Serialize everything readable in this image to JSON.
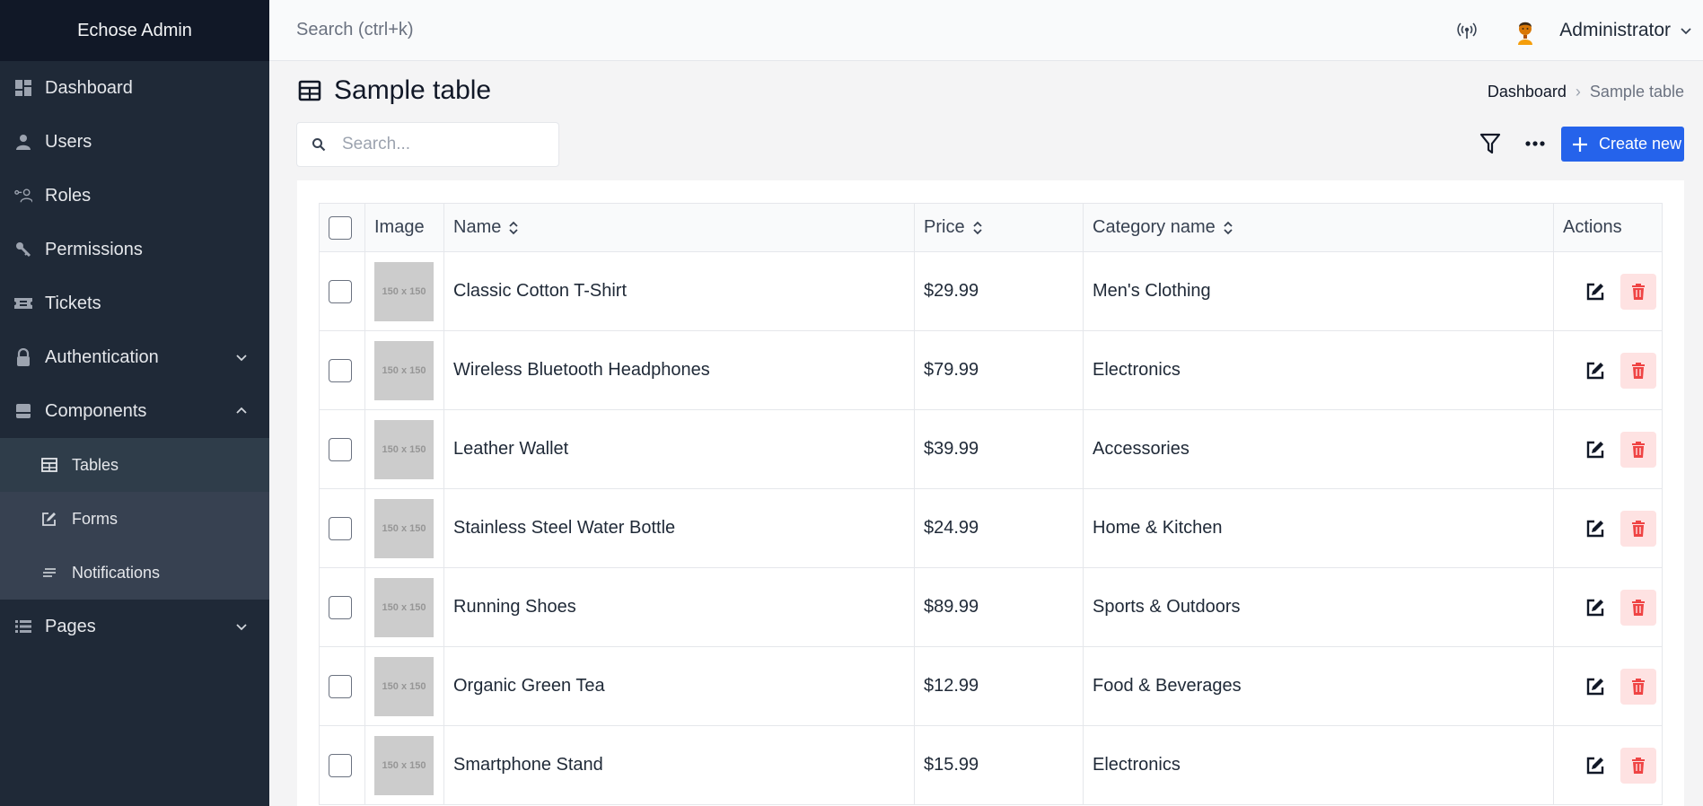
{
  "sidebar": {
    "brand": "Echose Admin",
    "items": [
      {
        "label": "Dashboard",
        "icon": "dashboard-icon"
      },
      {
        "label": "Users",
        "icon": "user-icon"
      },
      {
        "label": "Roles",
        "icon": "roles-icon"
      },
      {
        "label": "Permissions",
        "icon": "key-icon"
      },
      {
        "label": "Tickets",
        "icon": "ticket-icon"
      },
      {
        "label": "Authentication",
        "icon": "lock-icon",
        "expanded": false
      },
      {
        "label": "Components",
        "icon": "archive-icon",
        "expanded": true
      },
      {
        "label": "Pages",
        "icon": "list-icon",
        "expanded": false
      }
    ],
    "components_children": [
      {
        "label": "Tables",
        "icon": "table-icon",
        "active": true
      },
      {
        "label": "Forms",
        "icon": "edit-icon"
      },
      {
        "label": "Notifications",
        "icon": "notes-icon"
      }
    ]
  },
  "topbar": {
    "search_placeholder": "Search (ctrl+k)",
    "username": "Administrator"
  },
  "page": {
    "title": "Sample table",
    "breadcrumb": {
      "parent": "Dashboard",
      "current": "Sample table"
    }
  },
  "toolbar": {
    "search_placeholder": "Search...",
    "create_label": "Create new"
  },
  "table": {
    "headers": {
      "image": "Image",
      "name": "Name",
      "price": "Price",
      "category": "Category name",
      "actions": "Actions"
    },
    "placeholder_label": "150 x 150",
    "rows": [
      {
        "name": "Classic Cotton T-Shirt",
        "price": "$29.99",
        "category": "Men's Clothing"
      },
      {
        "name": "Wireless Bluetooth Headphones",
        "price": "$79.99",
        "category": "Electronics"
      },
      {
        "name": "Leather Wallet",
        "price": "$39.99",
        "category": "Accessories"
      },
      {
        "name": "Stainless Steel Water Bottle",
        "price": "$24.99",
        "category": "Home & Kitchen"
      },
      {
        "name": "Running Shoes",
        "price": "$89.99",
        "category": "Sports & Outdoors"
      },
      {
        "name": "Organic Green Tea",
        "price": "$12.99",
        "category": "Food & Beverages"
      },
      {
        "name": "Smartphone Stand",
        "price": "$15.99",
        "category": "Electronics"
      }
    ]
  },
  "colors": {
    "sidebar_bg": "#1f2937",
    "brand_bg": "#111827",
    "accent": "#2563eb",
    "delete_bg": "#fee2e2",
    "delete_icon": "#ef4444"
  }
}
